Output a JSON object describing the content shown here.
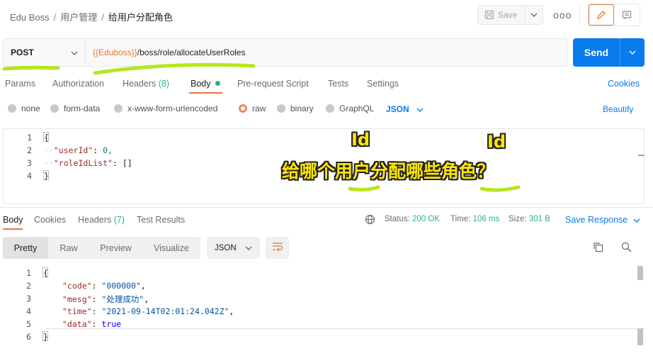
{
  "header": {
    "breadcrumb": [
      "Edu Boss",
      "用户管理",
      "给用户分配角色"
    ],
    "save_label": "Save",
    "more_label": "ooo"
  },
  "request": {
    "method": "POST",
    "url_variable": "{{Eduboss}}",
    "url_path": "/boss/role/allocateUserRoles",
    "send_label": "Send"
  },
  "request_tabs": {
    "params": "Params",
    "authorization": "Authorization",
    "headers": "Headers",
    "headers_count": "(8)",
    "body": "Body",
    "pre_request": "Pre-request Script",
    "tests": "Tests",
    "settings": "Settings",
    "cookies": "Cookies"
  },
  "body_types": {
    "none": "none",
    "form_data": "form-data",
    "urlencoded": "x-www-form-urlencoded",
    "raw": "raw",
    "binary": "binary",
    "graphql": "GraphQL",
    "format": "JSON",
    "beautify": "Beautify"
  },
  "request_body": {
    "lines": [
      "1",
      "2",
      "3",
      "4"
    ],
    "open": "{",
    "k1": "\"userId\"",
    "v1": "0,",
    "k2": "\"roleIdList\"",
    "v2": "[]",
    "close": "}"
  },
  "annotations": {
    "id_label_1": "Id",
    "id_label_2": "Id",
    "question": "给哪个用户分配哪些角色？"
  },
  "response_tabs": {
    "body": "Body",
    "cookies": "Cookies",
    "headers": "Headers",
    "headers_count": "(7)",
    "test_results": "Test Results"
  },
  "response_status": {
    "status_label": "Status:",
    "status_value": "200 OK",
    "time_label": "Time:",
    "time_value": "106 ms",
    "size_label": "Size:",
    "size_value": "301 B",
    "save_response": "Save Response"
  },
  "response_view": {
    "pretty": "Pretty",
    "raw": "Raw",
    "preview": "Preview",
    "visualize": "Visualize",
    "format": "JSON"
  },
  "response_body": {
    "lines": [
      "1",
      "2",
      "3",
      "4",
      "5",
      "6"
    ],
    "open": "{",
    "k1": "\"code\"",
    "v1": "\"000000\"",
    "k2": "\"mesg\"",
    "v2": "\"处理成功\"",
    "k3": "\"time\"",
    "v3": "\"2021-09-14T02:01:24.042Z\"",
    "k4": "\"data\"",
    "v4": "true",
    "close": "}"
  },
  "colors": {
    "accent_orange": "#e8773b",
    "send_blue": "#097bed",
    "green": "#26b47f",
    "highlight_yellow": "#ffe500",
    "marker_green": "#b6e61e"
  }
}
